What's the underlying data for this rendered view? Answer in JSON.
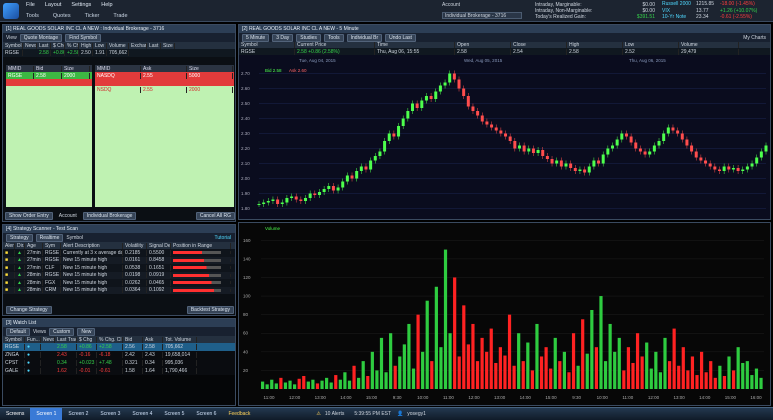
{
  "menu": {
    "items": [
      "File",
      "Layout",
      "Settings",
      "Help"
    ],
    "subtabs": [
      "Tools",
      "Quotes",
      "Ticker",
      "Trade"
    ]
  },
  "account": {
    "label": "Account",
    "value": "Individual Brokerage - 3716",
    "rows": [
      {
        "label": "Intraday, Marginable:",
        "value": "$0.00"
      },
      {
        "label": "Intraday, Non-Marginable:",
        "value": "$0.00"
      },
      {
        "label": "Today's Realized Gain:",
        "value": "$391.51"
      }
    ]
  },
  "indices": [
    {
      "name": "Russell 2000",
      "last": "1215.85",
      "chg": "-18.00 (-1.45%)"
    },
    {
      "name": "VIX",
      "last": "13.77",
      "chg": "+1.26 (+10.07%)"
    },
    {
      "name": "10-Yr Note",
      "last": "23.34",
      "chg": "-0.61 (-2.55%)"
    }
  ],
  "level2": {
    "title": "[1] REAL GOODS SOLAR INC CL A NEW : Individual Brokerage - 3716",
    "view_label": "View",
    "view_value": "Quote Montage",
    "find_label": "Find Symbol",
    "headers": [
      "Symbol",
      "News",
      "Last",
      "$ Chg",
      "% Chg",
      "High",
      "Low",
      "Volume",
      "Exchan",
      "Last",
      "Size"
    ],
    "quote": [
      "RGSE",
      "",
      "2.58",
      "+0.86",
      "+2.58",
      "2.50",
      "1.91",
      "705,662",
      "",
      "",
      ""
    ],
    "bid_headers": [
      "MMID",
      "Bid",
      "Size"
    ],
    "bids": [
      [
        "RGSE",
        "2.58",
        "2000"
      ],
      [
        "",
        "",
        ""
      ]
    ],
    "ask_headers": [
      "MMID",
      "Ask",
      "Size"
    ],
    "asks": [
      [
        "NASDQ",
        "2.55",
        "5000"
      ],
      [
        "",
        "",
        ""
      ],
      [
        "NSDQ",
        "2.55",
        "2000"
      ]
    ],
    "footer": {
      "show_order": "Show Order Entry",
      "account": "Account",
      "account_value": "Individual Brokerage",
      "cancel": "Cancel All RG"
    }
  },
  "chart": {
    "title": "[2] REAL GOODS SOLAR INC CL A NEW - 5 Minute",
    "toolbar": [
      "5 Minute",
      "3 Day",
      "Studies",
      "Tools",
      "Individual Br",
      "Undo Last"
    ],
    "headers": [
      "Symbol",
      "Current Price",
      "Time",
      "Open",
      "Close",
      "High",
      "Low",
      "Volume"
    ],
    "values": [
      "RGSE",
      "2.58 +0.86 (2.58%)",
      "Thu, Aug 06, 15:55",
      "2.58",
      "2.54",
      "2.58",
      "2.52",
      "29,479"
    ],
    "date_labels": [
      "Tue, Aug 04, 2015",
      "Wed, Aug 05, 2015",
      "Thu, Aug 06, 2015"
    ],
    "y_ticks": [
      "2.70",
      "2.60",
      "2.50",
      "2.40",
      "2.30",
      "2.20",
      "2.10",
      "2.00",
      "1.90",
      "1.80"
    ],
    "my_charts": "My Charts",
    "bid_tag": "Bid 2.58",
    "ask_tag": "Ask 2.60",
    "vol_label": "Volume",
    "vol_ticks": [
      "160",
      "140",
      "120",
      "100",
      "80",
      "60",
      "40",
      "20"
    ],
    "time_ticks": [
      "11:00",
      "12:00",
      "13:00",
      "14:00",
      "15:00",
      "9:30",
      "10:00",
      "11:00",
      "12:00",
      "13:00",
      "14:00",
      "15:00",
      "9:30",
      "10:00",
      "11:00",
      "12:00",
      "13:00",
      "14:00",
      "15:00",
      "16:00"
    ]
  },
  "chart_data": {
    "type": "line",
    "title": "",
    "xlabel": "",
    "ylabel": "",
    "ylim": [
      1.75,
      2.75
    ],
    "price": [
      1.83,
      1.84,
      1.85,
      1.86,
      1.83,
      1.84,
      1.87,
      1.88,
      1.86,
      1.85,
      1.87,
      1.9,
      1.89,
      1.91,
      1.93,
      1.95,
      1.92,
      1.94,
      1.98,
      2.02,
      2.0,
      2.05,
      2.08,
      2.06,
      2.12,
      2.15,
      2.18,
      2.25,
      2.3,
      2.28,
      2.35,
      2.4,
      2.45,
      2.5,
      2.47,
      2.52,
      2.55,
      2.53,
      2.58,
      2.62,
      2.64,
      2.7,
      2.66,
      2.6,
      2.55,
      2.48,
      2.45,
      2.42,
      2.38,
      2.36,
      2.34,
      2.32,
      2.3,
      2.28,
      2.25,
      2.2,
      2.22,
      2.18,
      2.2,
      2.17,
      2.19,
      2.15,
      2.13,
      2.1,
      2.12,
      2.08,
      2.1,
      2.07,
      2.05,
      2.06,
      2.04,
      2.08,
      2.12,
      2.1,
      2.16,
      2.2,
      2.22,
      2.26,
      2.3,
      2.28,
      2.24,
      2.2,
      2.18,
      2.16,
      2.18,
      2.22,
      2.25,
      2.3,
      2.34,
      2.32,
      2.3,
      2.26,
      2.22,
      2.18,
      2.14,
      2.12,
      2.1,
      2.08,
      2.06,
      2.05,
      2.08,
      2.06,
      2.07,
      2.05,
      2.06,
      2.08,
      2.1,
      2.14,
      2.18,
      2.22
    ],
    "volume": [
      8,
      5,
      10,
      6,
      12,
      7,
      9,
      5,
      11,
      14,
      8,
      10,
      6,
      9,
      12,
      7,
      15,
      10,
      18,
      9,
      25,
      12,
      30,
      14,
      40,
      20,
      55,
      18,
      60,
      25,
      35,
      48,
      70,
      22,
      80,
      40,
      95,
      30,
      110,
      45,
      150,
      60,
      120,
      35,
      90,
      48,
      70,
      30,
      55,
      40,
      65,
      28,
      45,
      36,
      80,
      25,
      60,
      30,
      50,
      20,
      70,
      35,
      45,
      22,
      55,
      30,
      40,
      18,
      60,
      25,
      75,
      38,
      85,
      45,
      100,
      30,
      70,
      40,
      55,
      20,
      45,
      28,
      60,
      35,
      50,
      22,
      40,
      18,
      55,
      30,
      65,
      25,
      45,
      20,
      35,
      15,
      40,
      18,
      30,
      12,
      25,
      14,
      35,
      20,
      45,
      28,
      30,
      15,
      22,
      12
    ]
  },
  "scanner": {
    "title": "[4] Strategy Scanner - Test Scan",
    "controls": [
      "Strategy",
      "Realtime",
      "Symbol",
      "Tutorial"
    ],
    "headers": [
      "Alert",
      "Dir.",
      "Age",
      "Sym",
      "Alert Description",
      "Volatility",
      "Signal Dev",
      "Position in Range"
    ],
    "rows": [
      [
        "",
        "27min",
        "RGSE",
        "Currently at 3 x average daily",
        "0.2185",
        "0.5500"
      ],
      [
        "",
        "27min",
        "RGSE",
        "New 15 minute high",
        "0.0161",
        "0.8458"
      ],
      [
        "",
        "27min",
        "CLF",
        "New 15 minute high",
        "0.0538",
        "0.1651"
      ],
      [
        "",
        "28min",
        "RGSE",
        "New 15 minute high",
        "0.0198",
        "0.0919"
      ],
      [
        "",
        "28min",
        "FGX",
        "New 15 minute high",
        "0.0262",
        "0.0465"
      ],
      [
        "",
        "28min",
        "CRM",
        "New 15 minute high",
        "0.0364",
        "0.1092"
      ]
    ],
    "change_btn": "Change Strategy",
    "backtest_btn": "Backtest Strategy"
  },
  "watchlist": {
    "title": "[3] Watch List",
    "selects": [
      "Default",
      "Views",
      "Custom",
      "New"
    ],
    "headers": [
      "Symbol",
      "Fun...",
      "News",
      "Last Trade",
      "$ Chg",
      "% Chg. Cl.",
      "Bid",
      "Ask",
      "Tot. Volume"
    ],
    "rows": [
      [
        "RGSE",
        "",
        "",
        "2.58",
        "+0.86",
        "+2.58",
        "2.56",
        "2.58",
        "705,662"
      ],
      [
        "ZNGA",
        "",
        "",
        "2.43",
        "-0.16",
        "-6.18",
        "2.42",
        "2.43",
        "19,658,014"
      ],
      [
        "CPST",
        "",
        "",
        "0.34",
        "+0.023",
        "+7.48",
        "0.321",
        "0.34",
        "995,036"
      ],
      [
        "GALE",
        "",
        "",
        "1.62",
        "-0.01",
        "-0.61",
        "1.58",
        "1.64",
        "1,790,466"
      ]
    ]
  },
  "taskbar": {
    "start": "Screens",
    "screens": [
      "Screen 1",
      "Screen 2",
      "Screen 3",
      "Screen 4",
      "Screen 5",
      "Screen 6"
    ],
    "feedback": "Feedback",
    "alerts": "10 Alerts",
    "time": "5:39:55 PM EST",
    "user": "yosegy1"
  }
}
